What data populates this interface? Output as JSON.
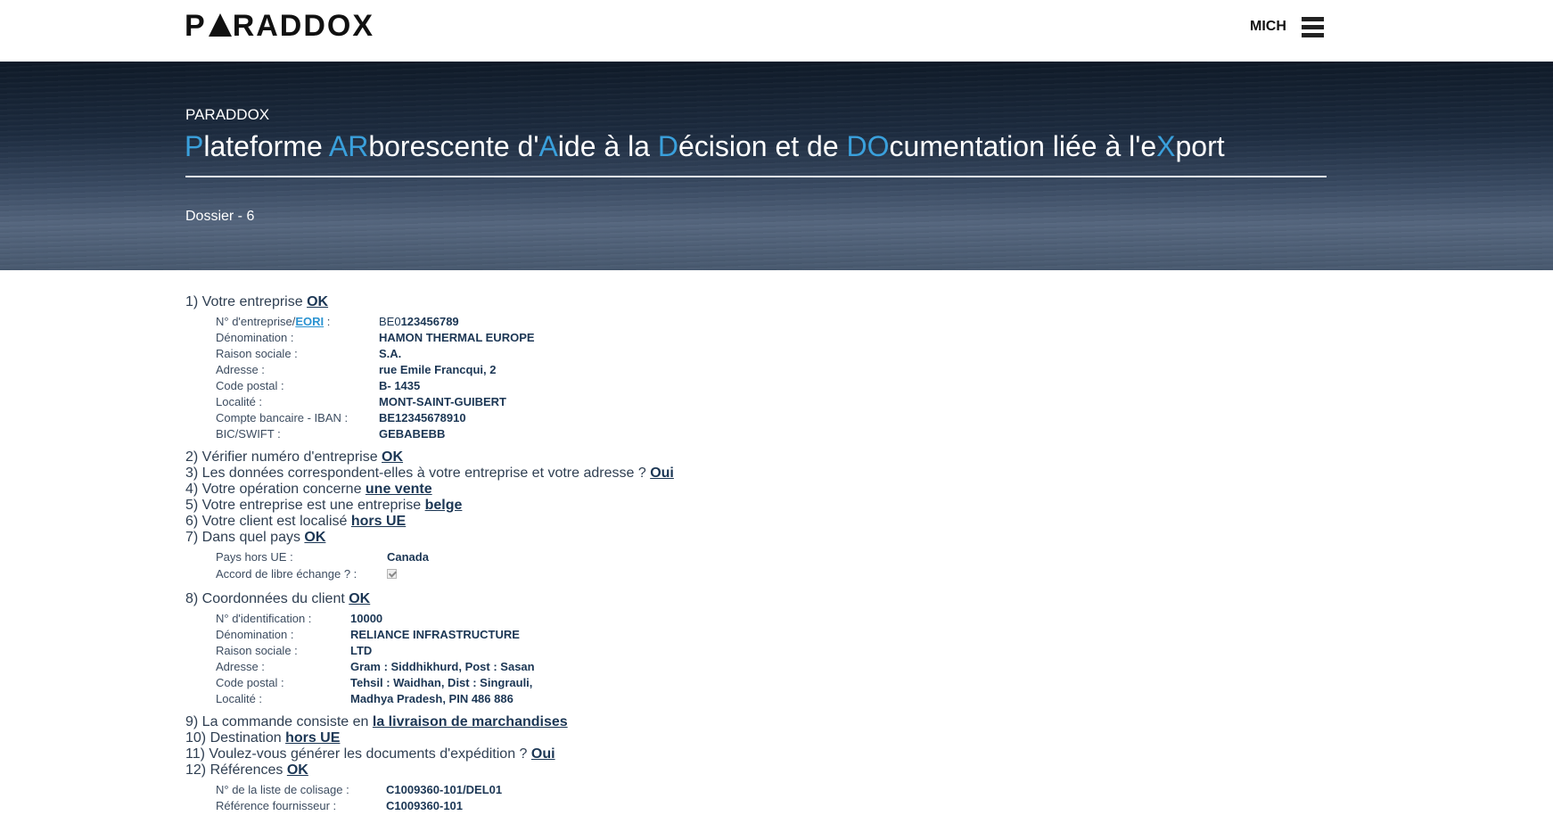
{
  "header": {
    "logo": {
      "before": "P",
      "after": "RADDOX"
    },
    "user": "MICH"
  },
  "hero": {
    "small_title": "PARADDOX",
    "title": [
      {
        "t": "P",
        "h": true
      },
      {
        "t": "lateforme ",
        "h": false
      },
      {
        "t": "AR",
        "h": true
      },
      {
        "t": "borescente d'",
        "h": false
      },
      {
        "t": "A",
        "h": true
      },
      {
        "t": "ide à la ",
        "h": false
      },
      {
        "t": "D",
        "h": true
      },
      {
        "t": "écision et de ",
        "h": false
      },
      {
        "t": "DO",
        "h": true
      },
      {
        "t": "cumentation liée à l'e",
        "h": false
      },
      {
        "t": "X",
        "h": true
      },
      {
        "t": "port",
        "h": false
      }
    ],
    "dossier": "Dossier - 6"
  },
  "questions": {
    "q1": {
      "text": "1) Votre entreprise ",
      "answer": "OK"
    },
    "q2": {
      "text": "2) Vérifier numéro d'entreprise ",
      "answer": "OK"
    },
    "q3": {
      "text": "3) Les données correspondent-elles à votre entreprise et votre adresse ? ",
      "answer": "Oui"
    },
    "q4": {
      "text": "4) Votre opération concerne ",
      "answer": "une vente"
    },
    "q5": {
      "text": "5) Votre entreprise est une entreprise ",
      "answer": "belge"
    },
    "q6": {
      "text": "6) Votre client est localisé ",
      "answer": "hors UE"
    },
    "q7": {
      "text": "7) Dans quel pays ",
      "answer": "OK"
    },
    "q8": {
      "text": "8) Coordonnées du client ",
      "answer": "OK"
    },
    "q9": {
      "text": "9) La commande consiste en ",
      "answer": "la livraison de marchandises"
    },
    "q10": {
      "text": "10) Destination ",
      "answer": "hors UE"
    },
    "q11": {
      "text": "11) Voulez-vous générer les documents d'expédition ? ",
      "answer": "Oui"
    },
    "q12": {
      "text": "12) Références ",
      "answer": "OK"
    }
  },
  "company": {
    "eori_prefix": "N° d'entreprise/",
    "eori_link": "EORI",
    "eori_suffix": " :",
    "eori_country": "BE0",
    "eori_value": "123456789",
    "rows": [
      {
        "label": "Dénomination :",
        "value": "HAMON THERMAL EUROPE"
      },
      {
        "label": "Raison sociale :",
        "value": "S.A."
      },
      {
        "label": "Adresse :",
        "value": "rue Emile Francqui, 2"
      },
      {
        "label": "Code postal :",
        "value": "B- 1435"
      },
      {
        "label": "Localité :",
        "value": "MONT-SAINT-GUIBERT"
      },
      {
        "label": "Compte bancaire - IBAN :",
        "value": "BE12345678910"
      },
      {
        "label": "BIC/SWIFT :",
        "value": "GEBABEBB"
      }
    ]
  },
  "country": {
    "rows": [
      {
        "label": "Pays hors UE :",
        "value": "Canada"
      },
      {
        "label": "Accord de libre échange ? :"
      }
    ],
    "free_trade_checked": true
  },
  "client": {
    "rows": [
      {
        "label": "N° d'identification :",
        "value": "10000"
      },
      {
        "label": "Dénomination :",
        "value": "RELIANCE INFRASTRUCTURE"
      },
      {
        "label": "Raison sociale :",
        "value": "LTD"
      },
      {
        "label": "Adresse :",
        "value": "Gram : Siddhikhurd, Post : Sasan"
      },
      {
        "label": "Code postal :",
        "value": "Tehsil : Waidhan, Dist : Singrauli,"
      },
      {
        "label": "Localité :",
        "value": "Madhya Pradesh, PIN 486 886"
      }
    ]
  },
  "references": {
    "rows": [
      {
        "label": "N° de la liste de colisage :",
        "value": "C1009360-101/DEL01"
      },
      {
        "label": "Référence fournisseur :",
        "value": "C1009360-101"
      }
    ]
  }
}
